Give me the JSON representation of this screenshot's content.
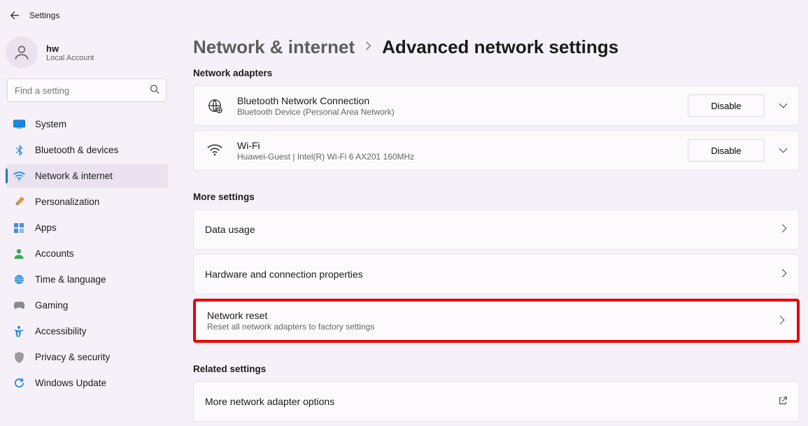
{
  "header": {
    "title": "Settings"
  },
  "user": {
    "name": "hw",
    "sub": "Local Account"
  },
  "search": {
    "placeholder": "Find a setting"
  },
  "sidebar": {
    "items": [
      {
        "label": "System"
      },
      {
        "label": "Bluetooth & devices"
      },
      {
        "label": "Network & internet"
      },
      {
        "label": "Personalization"
      },
      {
        "label": "Apps"
      },
      {
        "label": "Accounts"
      },
      {
        "label": "Time & language"
      },
      {
        "label": "Gaming"
      },
      {
        "label": "Accessibility"
      },
      {
        "label": "Privacy & security"
      },
      {
        "label": "Windows Update"
      }
    ]
  },
  "breadcrumb": {
    "parent": "Network & internet",
    "current": "Advanced network settings"
  },
  "sections": {
    "adapters_label": "Network adapters",
    "adapters": [
      {
        "title": "Bluetooth Network Connection",
        "sub": "Bluetooth Device (Personal Area Network)",
        "action": "Disable"
      },
      {
        "title": "Wi-Fi",
        "sub": "Huawei-Guest | Intel(R) Wi-Fi 6 AX201 160MHz",
        "action": "Disable"
      }
    ],
    "more_label": "More settings",
    "more": [
      {
        "title": "Data usage"
      },
      {
        "title": "Hardware and connection properties"
      },
      {
        "title": "Network reset",
        "sub": "Reset all network adapters to factory settings"
      }
    ],
    "related_label": "Related settings",
    "related": [
      {
        "title": "More network adapter options"
      }
    ]
  }
}
